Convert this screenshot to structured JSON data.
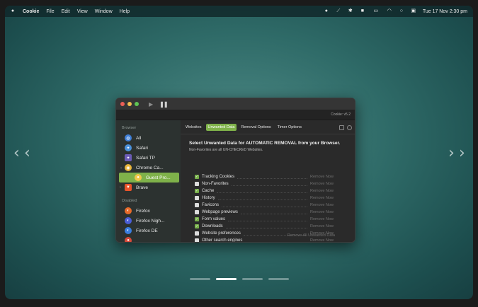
{
  "menubar": {
    "app_name": "Cookie",
    "menus": [
      "File",
      "Edit",
      "View",
      "Window",
      "Help"
    ],
    "clock": "Tue 17 Nov  2:30 pm"
  },
  "nav": {
    "prev_arrow": "‹",
    "next_arrow": "›"
  },
  "carousel": {
    "page_count": 4,
    "active_page": 2
  },
  "window": {
    "version": "Cookie: v5.2",
    "controls": {
      "play": "▶",
      "pause": "❚❚"
    },
    "sidebar": {
      "sections": [
        {
          "header": "Browser",
          "items": [
            {
              "label": "All",
              "icon": "globe-icon",
              "color": "#3f7fd6"
            },
            {
              "label": "Safari",
              "icon": "safari-icon",
              "color": "#4a90d9"
            },
            {
              "label": "Safari TP",
              "icon": "safari-tp-icon",
              "color": "#6b5bb5"
            },
            {
              "label": "Chrome Ca...",
              "icon": "chrome-canary-icon",
              "color": "#e8b43a",
              "expanded": true
            },
            {
              "label": "Guest Pro...",
              "icon": "profile-icon",
              "color": "#f0c84a",
              "selected": true
            },
            {
              "label": "Brave",
              "icon": "brave-icon",
              "color": "#e8542a",
              "collapsed": true
            }
          ]
        },
        {
          "header": "Disabled",
          "items": [
            {
              "label": "Firefox",
              "icon": "firefox-icon",
              "color": "#e66a2a"
            },
            {
              "label": "Firefox Nigh...",
              "icon": "firefox-nightly-icon",
              "color": "#4a5ed6"
            },
            {
              "label": "Firefox DE",
              "icon": "firefox-de-icon",
              "color": "#3a7ee0"
            },
            {
              "label": "",
              "icon": "browser-icon",
              "color": "#d64a3a"
            }
          ]
        }
      ]
    },
    "tabs": [
      "Websites",
      "Unwanted Data",
      "Removal Options",
      "Timer Options"
    ],
    "active_tab": 1,
    "heading": "Select Unwanted Data for AUTOMATIC REMOVAL from your Browser.",
    "subheading": "Non-Favorites are all UN-CHECKED Websites.",
    "remove_label": "Remove Now",
    "options": [
      {
        "label": "Tracking Cookies",
        "checked": true
      },
      {
        "label": "Non-Favorites",
        "checked": false
      },
      {
        "label": "Cache",
        "checked": true
      },
      {
        "label": "History",
        "checked": false
      },
      {
        "label": "Favicons",
        "checked": false
      },
      {
        "label": "Webpage previews",
        "checked": false
      },
      {
        "label": "Form values",
        "checked": true
      },
      {
        "label": "Downloads",
        "checked": true
      },
      {
        "label": "Website preferences",
        "checked": false
      },
      {
        "label": "Other search engines",
        "checked": false
      }
    ],
    "remove_all_label": "Remove All Unwanted Data"
  }
}
